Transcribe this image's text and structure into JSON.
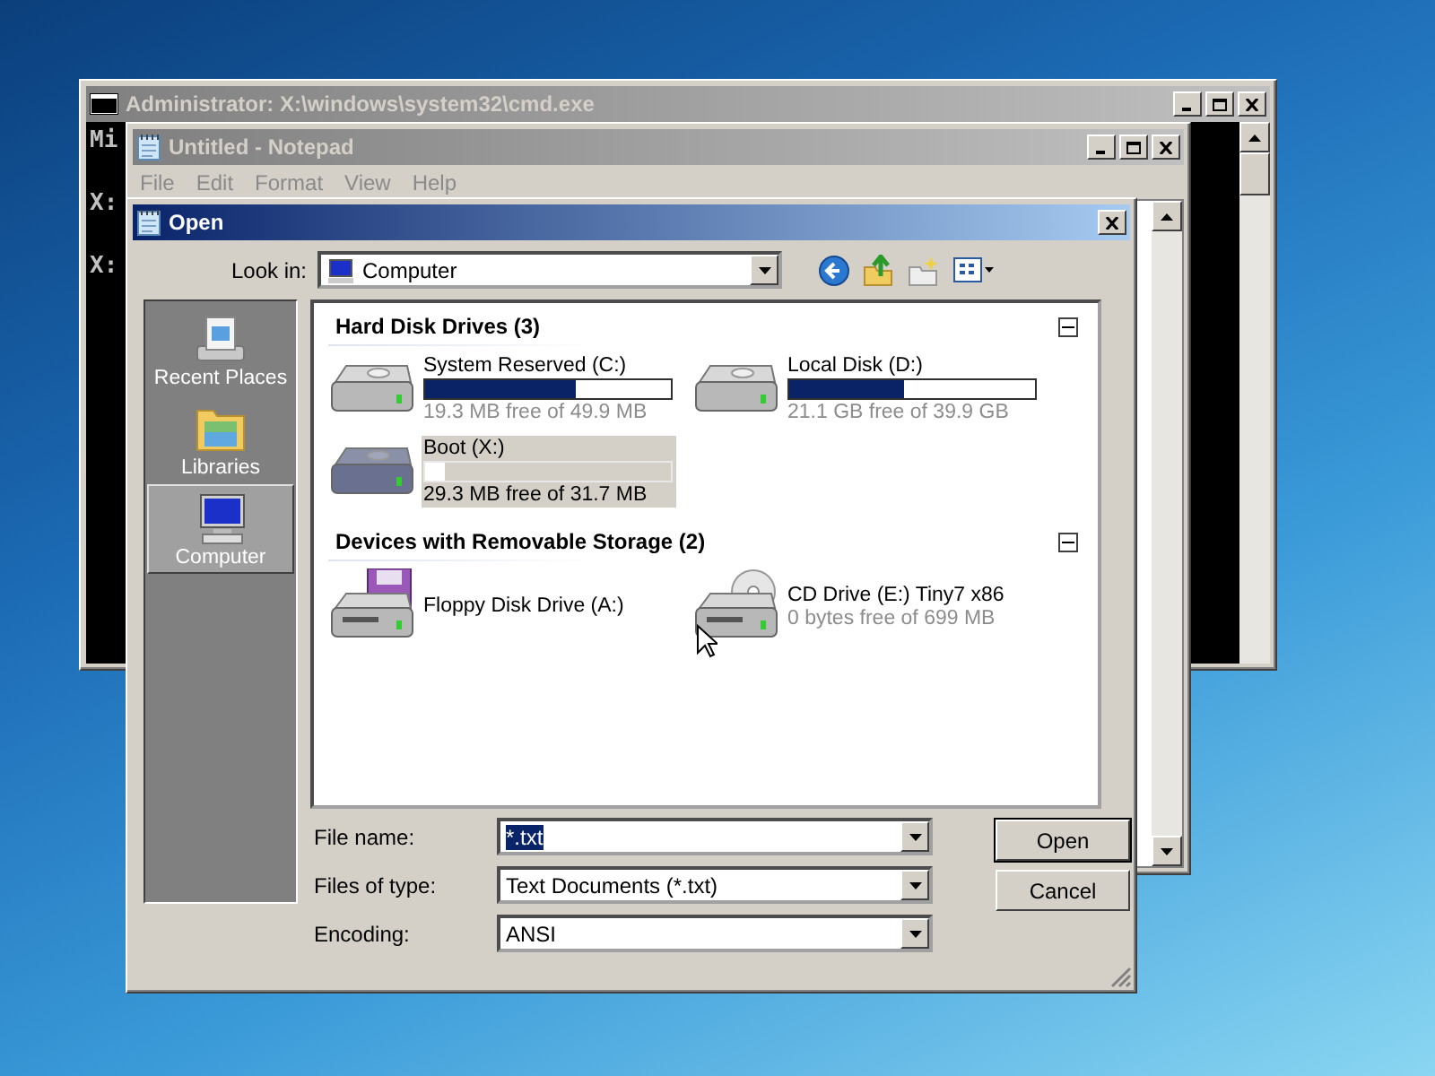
{
  "cmd_window": {
    "title": "Administrator: X:\\windows\\system32\\cmd.exe",
    "console_lines": [
      "Mi",
      "X:",
      "X:"
    ]
  },
  "notepad_window": {
    "title": "Untitled - Notepad",
    "menu": [
      "File",
      "Edit",
      "Format",
      "View",
      "Help"
    ]
  },
  "open_dialog": {
    "title": "Open",
    "look_in": {
      "label": "Look in:",
      "value": "Computer"
    },
    "places": [
      {
        "label": "Recent Places",
        "kind": "recent",
        "selected": false
      },
      {
        "label": "Libraries",
        "kind": "libraries",
        "selected": false
      },
      {
        "label": "Computer",
        "kind": "computer",
        "selected": true
      }
    ],
    "groups": [
      {
        "title": "Hard Disk Drives (3)",
        "expanded": true,
        "items": [
          {
            "kind": "hdd",
            "name": "System Reserved (C:)",
            "level": 0.61,
            "free": "19.3 MB free of 49.9 MB",
            "selected": false
          },
          {
            "kind": "hdd",
            "name": "Local Disk (D:)",
            "level": 0.47,
            "free": "21.1 GB free of 39.9 GB",
            "selected": false
          },
          {
            "kind": "hdd",
            "name": "Boot (X:)",
            "level": 0.08,
            "free": "29.3 MB free of 31.7 MB",
            "selected": true
          }
        ]
      },
      {
        "title": "Devices with Removable Storage (2)",
        "expanded": true,
        "items": [
          {
            "kind": "floppy",
            "name": "Floppy Disk Drive (A:)",
            "selected": false
          },
          {
            "kind": "cd",
            "name": "CD Drive (E:) Tiny7 x86",
            "free": "0 bytes free of 699 MB",
            "selected": false
          }
        ]
      }
    ],
    "file_name": {
      "label": "File name:",
      "value": "*.txt",
      "text_selected": true
    },
    "file_type": {
      "label": "Files of type:",
      "value": "Text Documents (*.txt)"
    },
    "encoding": {
      "label": "Encoding:",
      "value": "ANSI"
    },
    "buttons": [
      {
        "label": "Open",
        "default": true
      },
      {
        "label": "Cancel",
        "default": false
      }
    ]
  }
}
